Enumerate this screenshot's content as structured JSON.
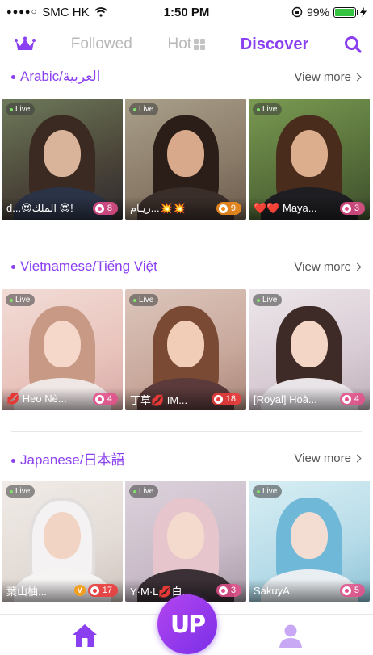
{
  "status_bar": {
    "carrier": "SMC HK",
    "time": "1:50 PM",
    "battery": "99%",
    "battery_level": 0.99
  },
  "nav": {
    "tabs": [
      {
        "label": "Followed",
        "active": false
      },
      {
        "label": "Hot",
        "active": false
      },
      {
        "label": "Discover",
        "active": true
      }
    ],
    "accent": "#8a3ff0"
  },
  "sections": [
    {
      "title": "Arabic/العربية",
      "view_more": "View more",
      "cards": [
        {
          "live": "Live",
          "name": "d...😍الملك 😍!",
          "count": "8",
          "pill": "pink"
        },
        {
          "live": "Live",
          "name": "ريـام...💥💥",
          "count": "9",
          "pill": "orange"
        },
        {
          "live": "Live",
          "name": "❤️❤️ Maya...",
          "count": "3",
          "pill": "pink"
        }
      ]
    },
    {
      "title": "Vietnamese/Tiếng Việt",
      "view_more": "View more",
      "cards": [
        {
          "live": "Live",
          "name": "💋 Heo Nè...",
          "count": "4",
          "pill": "pink"
        },
        {
          "live": "Live",
          "name": "丁草💋 IM...",
          "count": "18",
          "pill": "red"
        },
        {
          "live": "Live",
          "name": "[Royal] Hoà...",
          "count": "4",
          "pill": "pink"
        }
      ]
    },
    {
      "title": "Japanese/日本語",
      "view_more": "View more",
      "cards": [
        {
          "live": "Live",
          "name": "葉山柚...",
          "count": "17",
          "pill": "red",
          "vip": "V"
        },
        {
          "live": "Live",
          "name": "Y·M·L💋白...",
          "count": "3",
          "pill": "pink"
        },
        {
          "live": "Live",
          "name": "SakuyA",
          "count": "5",
          "pill": "pink"
        }
      ]
    }
  ],
  "tab_bar": {
    "center_label": "UP",
    "icons": [
      "home-icon",
      "profile-icon"
    ]
  }
}
